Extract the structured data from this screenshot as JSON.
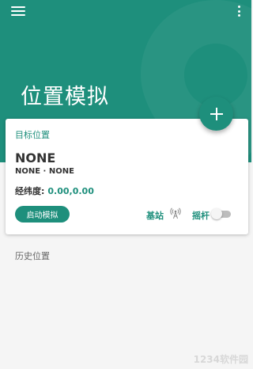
{
  "header": {
    "title": "位置模拟",
    "background_color": "#1e8f7c",
    "menu_icon": "hamburger-menu-icon",
    "more_icon": "more-vertical-icon"
  },
  "fab": {
    "icon": "plus-icon"
  },
  "card": {
    "label": "目标位置",
    "location_name": "NONE",
    "location_sub": "NONE · NONE",
    "coords_label": "经纬度:",
    "coords_value": "0.00,0.00",
    "start_button": "启动模拟",
    "station_label": "基站",
    "station_icon": "cell-tower-icon",
    "joystick_label": "摇杆",
    "joystick_enabled": false
  },
  "history": {
    "label": "历史位置"
  },
  "watermark": {
    "text": "1234软件园"
  },
  "colors": {
    "accent": "#1e8f7c",
    "text": "#333333",
    "background": "#f5f5f5"
  }
}
